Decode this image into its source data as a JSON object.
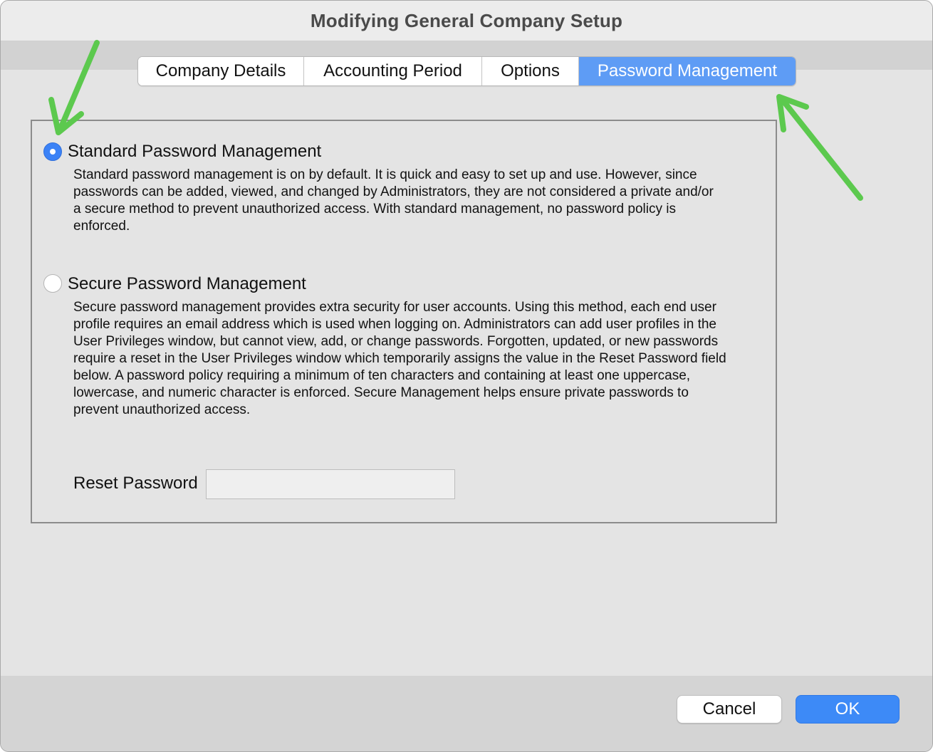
{
  "window": {
    "title": "Modifying General Company Setup"
  },
  "tabs": [
    {
      "label": "Company Details",
      "active": false
    },
    {
      "label": "Accounting Period",
      "active": false
    },
    {
      "label": "Options",
      "active": false
    },
    {
      "label": "Password Management",
      "active": true
    }
  ],
  "password_management": {
    "standard": {
      "label": "Standard Password Management",
      "selected": true,
      "description": "Standard password management is on by default. It is quick and easy to set up and use. However, since passwords can be added, viewed, and changed by Administrators, they are not considered a private and/or a secure method to prevent unauthorized access. With standard management, no password policy is enforced."
    },
    "secure": {
      "label": "Secure Password Management",
      "selected": false,
      "description": "Secure password management provides extra security for user accounts. Using this method, each end user profile requires an email address which is used when logging on. Administrators can add user profiles in the User Privileges window, but cannot view, add, or change passwords. Forgotten, updated, or new passwords require a reset in the User Privileges window which temporarily assigns the value in the Reset Password field below. A password policy requiring a minimum of ten characters and containing at least one uppercase, lowercase, and numeric character is enforced. Secure Management helps ensure private passwords to prevent unauthorized access."
    },
    "reset_password": {
      "label": "Reset Password",
      "value": "",
      "placeholder": ""
    }
  },
  "buttons": {
    "cancel": "Cancel",
    "ok": "OK"
  },
  "colors": {
    "accent": "#3d8af7",
    "active_tab": "#5e9cf5",
    "annotation_arrow": "#5cc94e"
  }
}
